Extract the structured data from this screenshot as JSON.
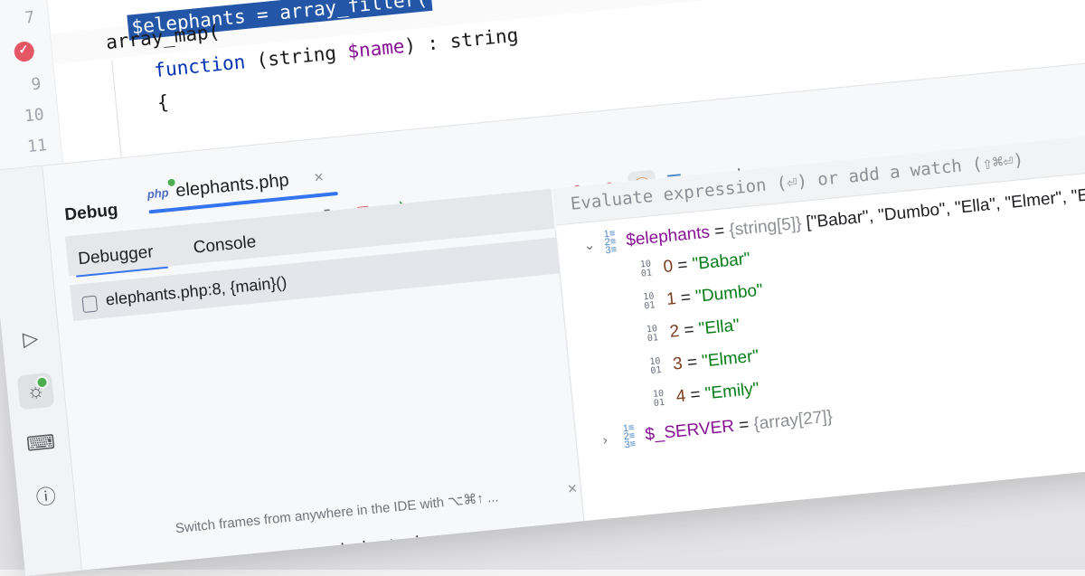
{
  "editor": {
    "lines": [
      {
        "num": "",
        "code_plain": "];"
      },
      {
        "num": "7",
        "code_plain": ""
      },
      {
        "num": "",
        "sel": "$elephants = array_filter(",
        "code_plain": ""
      },
      {
        "num": "9",
        "code_plain": ""
      },
      {
        "num": "10",
        "code_plain": ""
      },
      {
        "num": "11",
        "code_plain": ""
      }
    ],
    "line1": "];",
    "line_sel": "$elephants = array_filter(",
    "line_map": "array_map(",
    "fn_kw": "function",
    "fn_open": " (string ",
    "fn_var": "$name",
    "fn_close": ") : string",
    "brace": "{",
    "ln7": "7",
    "ln9": "9",
    "ln10": "10",
    "ln11": "11"
  },
  "debug": {
    "title": "Debug",
    "run_tab_label": "elephants.php",
    "php_badge": "php",
    "tab_close": "×",
    "subtabs": {
      "debugger": "Debugger",
      "console": "Console"
    },
    "frame": "elephants.php:8, {main}()",
    "hint": "Switch frames from anywhere in the IDE with ⌥⌘↑ ...",
    "hint_close": "×",
    "bottom_file": "elephants.php",
    "eval_placeholder": "Evaluate expression (⏎) or add a watch (⇧⌘⏎)",
    "right_label": "P"
  },
  "variables": {
    "elephants": {
      "name": "$elephants",
      "type": "{string[5]}",
      "preview": "[\"Babar\", \"Dumbo\", \"Ella\", \"Elmer\", \"Emily\"]",
      "items": [
        {
          "index": "0",
          "value": "\"Babar\""
        },
        {
          "index": "1",
          "value": "\"Dumbo\""
        },
        {
          "index": "2",
          "value": "\"Ella\""
        },
        {
          "index": "3",
          "value": "\"Elmer\""
        },
        {
          "index": "4",
          "value": "\"Emily\""
        }
      ]
    },
    "server": {
      "name": "$_SERVER",
      "type": "{array[27]}"
    }
  },
  "icons": [
    "layout-icon",
    "chevron-down-icon",
    "add-watch-icon",
    "rerun-icon",
    "stop-icon",
    "resume-icon",
    "pause-icon",
    "step-over-icon",
    "step-into-icon",
    "step-out-icon",
    "view-breakpoints-icon",
    "mute-breakpoints-icon",
    "php-c-icon",
    "list-icon",
    "add-list-icon",
    "more-icon",
    "run-icon",
    "debug-icon",
    "terminal-icon",
    "problems-icon"
  ],
  "colors": {
    "accent": "#3574f0",
    "selection": "#2456a8",
    "string": "#067d17",
    "variable": "#871094",
    "breakpoint": "#e55765",
    "success": "#4cae4f"
  }
}
